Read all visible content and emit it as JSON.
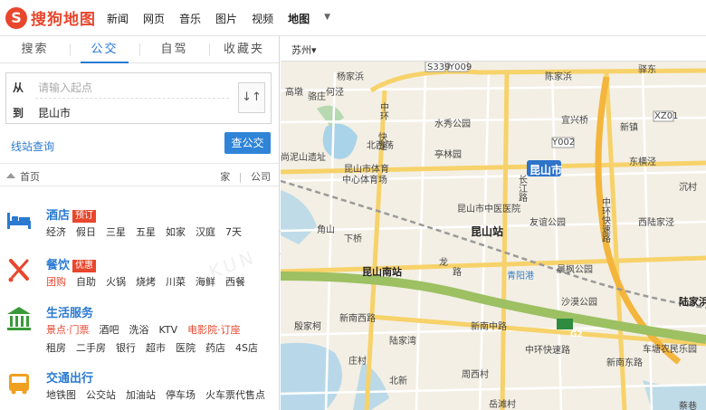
{
  "logo": {
    "badge": "S",
    "text": "搜狗地图"
  },
  "nav": {
    "items": [
      "新闻",
      "网页",
      "音乐",
      "图片",
      "视频",
      "地图"
    ],
    "dropdown": "▼"
  },
  "tabs": [
    "搜索",
    "公交",
    "自驾",
    "收藏夹"
  ],
  "route": {
    "from_label": "从",
    "from_placeholder": "请输入起点",
    "to_label": "到",
    "to_value": "昆山市",
    "swap": "↓↑"
  },
  "line_station_link": "线站查询",
  "bus_button": "查公交",
  "breadcrumb": {
    "home": "首页",
    "home_link": "家",
    "sep": "|",
    "company_link": "公司"
  },
  "categories": [
    {
      "title": "酒店",
      "tag": "预订",
      "items": [
        "经济",
        "假日",
        "三星",
        "五星",
        "如家",
        "汉庭",
        "7天"
      ]
    },
    {
      "title": "餐饮",
      "tag": "优惠",
      "items": [
        "团购",
        "自助",
        "火锅",
        "烧烤",
        "川菜",
        "海鲜",
        "西餐"
      ]
    },
    {
      "title": "生活服务",
      "items": [
        "景点·门票",
        "酒吧",
        "洗浴",
        "KTV",
        "电影院·订座",
        "租房",
        "二手房",
        "银行",
        "超市",
        "医院",
        "药店",
        "4S店"
      ]
    },
    {
      "title": "交通出行",
      "items": [
        "地铁图",
        "公交站",
        "加油站",
        "停车场",
        "火车票代售点"
      ]
    }
  ],
  "city": "苏州▾",
  "map_labels": [
    "杨家浜",
    "S339",
    "Y009",
    "陈家浜",
    "驿东",
    "何泾",
    "骆庄",
    "高墩",
    "水秀公园",
    "宜兴桥",
    "XZ01",
    "中",
    "环",
    "亭林园",
    "新镇",
    "快",
    "速",
    "北西荡",
    "Y002",
    "东横泾",
    "尚泥山遗址",
    "昆山市体育",
    "中心体育场",
    "昆山市",
    "沉村",
    "中",
    "环",
    "快",
    "速",
    "路",
    "昆山市中医医院",
    "西陆家泾",
    "友谊公园",
    "角山",
    "昆山站",
    "长",
    "江",
    "路",
    "下桥",
    "龙",
    "路",
    "昆山南站",
    "青阳港",
    "晨枫公园",
    "沙漠公园",
    "陆家浜站",
    "新南西路",
    "新南中路",
    "中环快速路",
    "G2",
    "殷家柯",
    "陆家湾",
    "新南东路",
    "车塘农民乐园",
    "庄村",
    "北新",
    "周西村",
    "岳滩村",
    "蔡巷"
  ],
  "watermark": "KUN"
}
